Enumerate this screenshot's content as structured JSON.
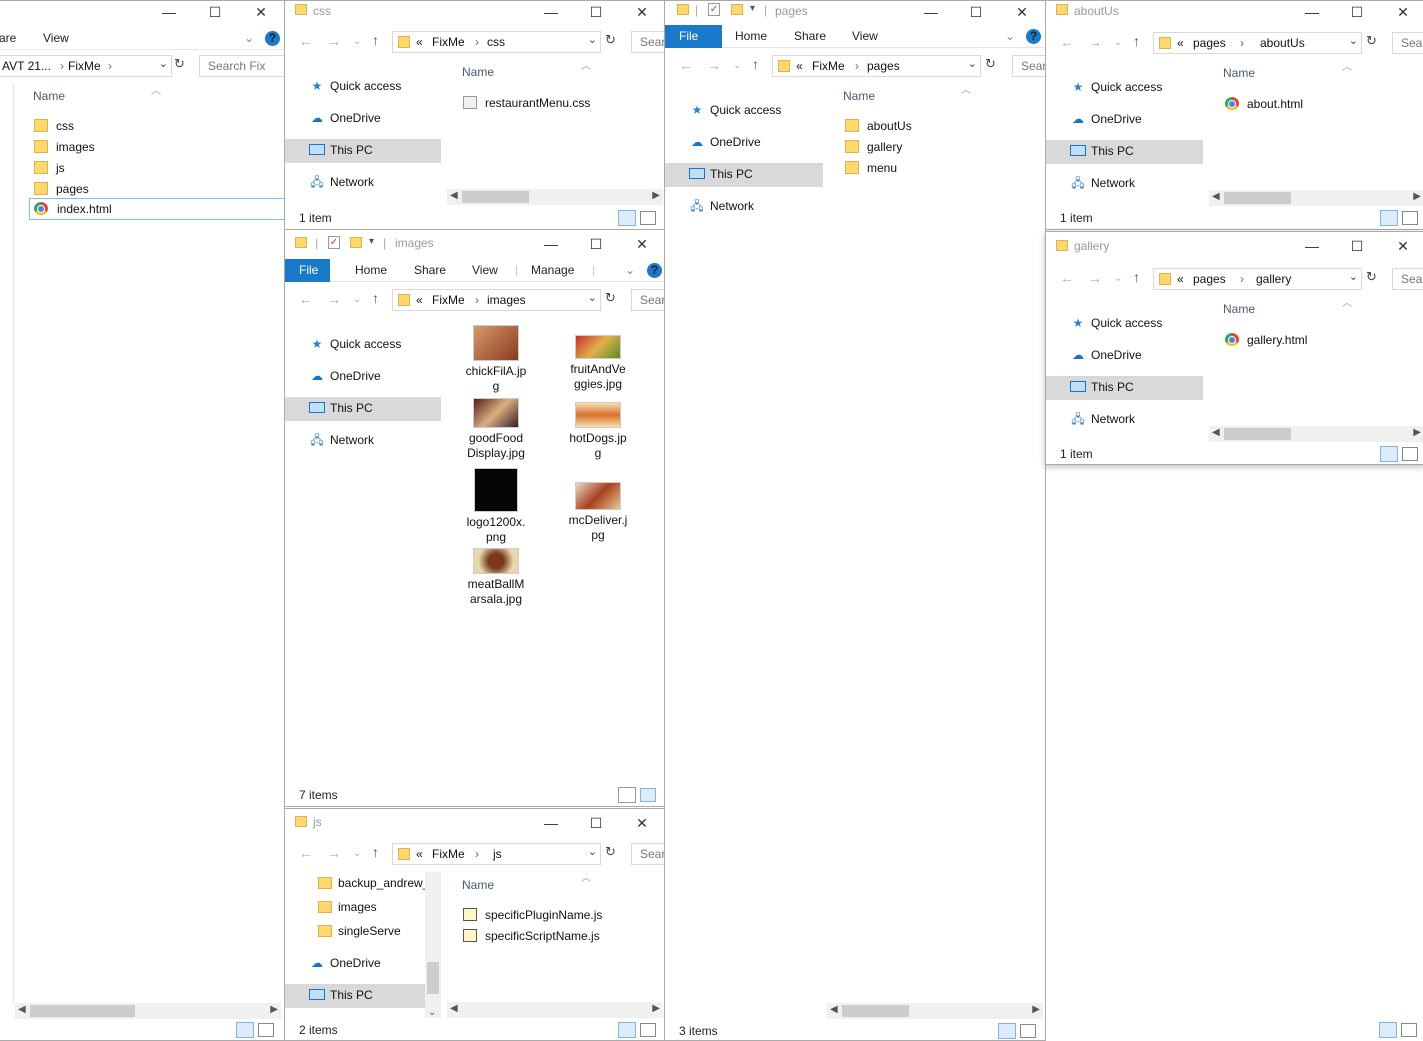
{
  "fixme_window": {
    "ribbon": [
      "are",
      "View"
    ],
    "address": [
      "AVT 21...",
      "FixMe"
    ],
    "search_placeholder": "Search Fix",
    "column": "Name",
    "items": [
      {
        "name": "css",
        "icon": "folder-icon"
      },
      {
        "name": "images",
        "icon": "folder-icon"
      },
      {
        "name": "js",
        "icon": "folder-icon"
      },
      {
        "name": "pages",
        "icon": "folder-icon"
      },
      {
        "name": "index.html",
        "icon": "chrome-html-icon"
      }
    ]
  },
  "css_window": {
    "title": "css",
    "address": [
      "«",
      "FixMe",
      "css"
    ],
    "search_placeholder": "Search",
    "nav": [
      "Quick access",
      "OneDrive",
      "This PC",
      "Network"
    ],
    "column": "Name",
    "items": [
      {
        "name": "restaurantMenu.css",
        "icon": "css-file-icon"
      }
    ],
    "status": "1 item"
  },
  "images_window": {
    "title": "images",
    "ribbon": {
      "file": "File",
      "home": "Home",
      "share": "Share",
      "view": "View",
      "manage": "Manage"
    },
    "address": [
      "«",
      "FixMe",
      "images"
    ],
    "search_placeholder": "Search",
    "nav": [
      "Quick access",
      "OneDrive",
      "This PC",
      "Network"
    ],
    "items": [
      {
        "line1": "chickFilA.jp",
        "line2": "g",
        "color": "#b0603a"
      },
      {
        "line1": "fruitAndVe",
        "line2": "ggies.jpg",
        "color": "#a8703a"
      },
      {
        "line1": "goodFood",
        "line2": "Display.jpg",
        "color": "#7a3a30"
      },
      {
        "line1": "hotDogs.jp",
        "line2": "g",
        "color": "#d8903a"
      },
      {
        "line1": "logo1200x.",
        "line2": "png",
        "color": "#050505"
      },
      {
        "line1": "mcDeliver.j",
        "line2": "pg",
        "color": "#9c4a30"
      },
      {
        "line1": "meatBallM",
        "line2": "arsala.jpg",
        "color": "#a0602c"
      }
    ],
    "status": "7 items"
  },
  "js_window": {
    "title": "js",
    "address": [
      "«",
      "FixMe",
      "js"
    ],
    "search_placeholder": "Search",
    "nav": [
      "backup_andrew_",
      "images",
      "singleServe",
      "OneDrive",
      "This PC"
    ],
    "column": "Name",
    "items": [
      {
        "name": "specificPluginName.js",
        "icon": "js-file-icon"
      },
      {
        "name": "specificScriptName.js",
        "icon": "js-file-icon"
      }
    ],
    "status": "2 items"
  },
  "pages_window": {
    "title": "pages",
    "ribbon": {
      "file": "File",
      "home": "Home",
      "share": "Share",
      "view": "View"
    },
    "address": [
      "«",
      "FixMe",
      "pages"
    ],
    "search_placeholder": "Search",
    "nav": [
      "Quick access",
      "OneDrive",
      "This PC",
      "Network"
    ],
    "column": "Name",
    "items": [
      {
        "name": "aboutUs",
        "icon": "folder-icon"
      },
      {
        "name": "gallery",
        "icon": "folder-icon"
      },
      {
        "name": "menu",
        "icon": "folder-icon"
      }
    ],
    "status": "3 items"
  },
  "aboutus_window": {
    "title": "aboutUs",
    "address": [
      "«",
      "pages",
      "aboutUs"
    ],
    "search_placeholder": "Search",
    "nav": [
      "Quick access",
      "OneDrive",
      "This PC",
      "Network"
    ],
    "column": "Name",
    "items": [
      {
        "name": "about.html",
        "icon": "chrome-html-icon"
      }
    ],
    "status": "1 item"
  },
  "gallery_window": {
    "title": "gallery",
    "address": [
      "«",
      "pages",
      "gallery"
    ],
    "search_placeholder": "Search",
    "nav": [
      "Quick access",
      "OneDrive",
      "This PC",
      "Network"
    ],
    "column": "Name",
    "items": [
      {
        "name": "gallery.html",
        "icon": "chrome-html-icon"
      }
    ],
    "status": "1 item"
  },
  "window_controls": {
    "minimize": "—",
    "maximize": "☐",
    "close": "✕"
  },
  "colors": {
    "accent": "#1979ca",
    "folder": "#ffd86b",
    "selected_nav": "#d9d9d9"
  }
}
